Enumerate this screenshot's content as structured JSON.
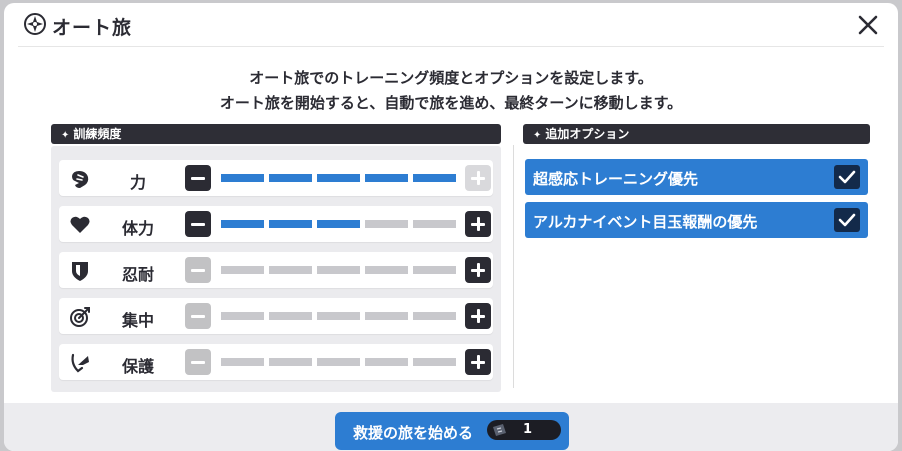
{
  "header": {
    "title": "オート旅",
    "title_icon": "compass-star-icon",
    "close_icon": "close-icon"
  },
  "description": {
    "line1": "オート旅でのトレーニング頻度とオプションを設定します。",
    "line2": "オート旅を開始すると、自動で旅を進め、最終ターンに移動します。"
  },
  "training": {
    "section_title": "訓練頻度",
    "max_level": 5,
    "rows": [
      {
        "label": "力",
        "icon": "fist-icon",
        "level": 5
      },
      {
        "label": "体力",
        "icon": "heart-icon",
        "level": 3
      },
      {
        "label": "忍耐",
        "icon": "shield-icon",
        "level": 0
      },
      {
        "label": "集中",
        "icon": "target-icon",
        "level": 0
      },
      {
        "label": "保護",
        "icon": "protect-icon",
        "level": 0
      }
    ]
  },
  "options": {
    "section_title": "追加オプション",
    "items": [
      {
        "label": "超感応トレーニング優先",
        "checked": true
      },
      {
        "label": "アルカナイベント目玉報酬の優先",
        "checked": true
      }
    ]
  },
  "footer": {
    "start_label": "救援の旅を始める",
    "ticket_icon": "ticket-icon",
    "ticket_count": "1"
  },
  "colors": {
    "accent": "#2d7dd2",
    "dark": "#2b2b33",
    "inactive": "#c8c8cc"
  }
}
